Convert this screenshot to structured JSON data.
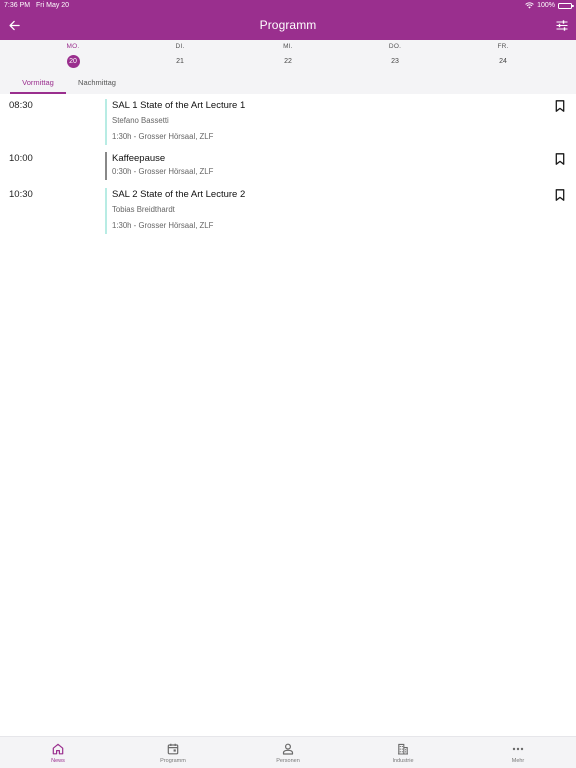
{
  "status": {
    "time": "7:36 PM",
    "date": "Fri May 20",
    "battery": "100%",
    "battery_level": 1.0
  },
  "header": {
    "title": "Programm",
    "back_icon": "arrow-left-icon",
    "filter_icon": "sliders-icon"
  },
  "days": [
    {
      "name": "MO.",
      "num": "20",
      "active": true
    },
    {
      "name": "DI.",
      "num": "21",
      "active": false
    },
    {
      "name": "MI.",
      "num": "22",
      "active": false
    },
    {
      "name": "DO.",
      "num": "23",
      "active": false
    },
    {
      "name": "FR.",
      "num": "24",
      "active": false
    }
  ],
  "tabs": [
    {
      "label": "Vormittag",
      "active": true
    },
    {
      "label": "Nachmittag",
      "active": false
    }
  ],
  "sessions": [
    {
      "time": "08:30",
      "title": "SAL 1 State of the Art Lecture 1",
      "speaker": "Stefano Bassetti",
      "details": "1:30h - Grosser Hörsaal, ZLF",
      "color": "#b8ece4"
    },
    {
      "time": "10:00",
      "title": "Kaffeepause",
      "speaker": "",
      "details": "0:30h - Grosser Hörsaal, ZLF",
      "color": "#888888"
    },
    {
      "time": "10:30",
      "title": "SAL 2 State of the Art Lecture 2",
      "speaker": "Tobias Breidthardt",
      "details": "1:30h - Grosser Hörsaal, ZLF",
      "color": "#b8ece4"
    }
  ],
  "bottom_nav": [
    {
      "label": "News",
      "icon": "home-icon",
      "active": true
    },
    {
      "label": "Programm",
      "icon": "calendar-icon",
      "active": false
    },
    {
      "label": "Personen",
      "icon": "person-icon",
      "active": false
    },
    {
      "label": "Industrie",
      "icon": "building-icon",
      "active": false
    },
    {
      "label": "Mehr",
      "icon": "more-icon",
      "active": false
    }
  ],
  "colors": {
    "brand": "#9a2f8e",
    "accent_bar": "#b8ece4",
    "break_bar": "#888888"
  }
}
